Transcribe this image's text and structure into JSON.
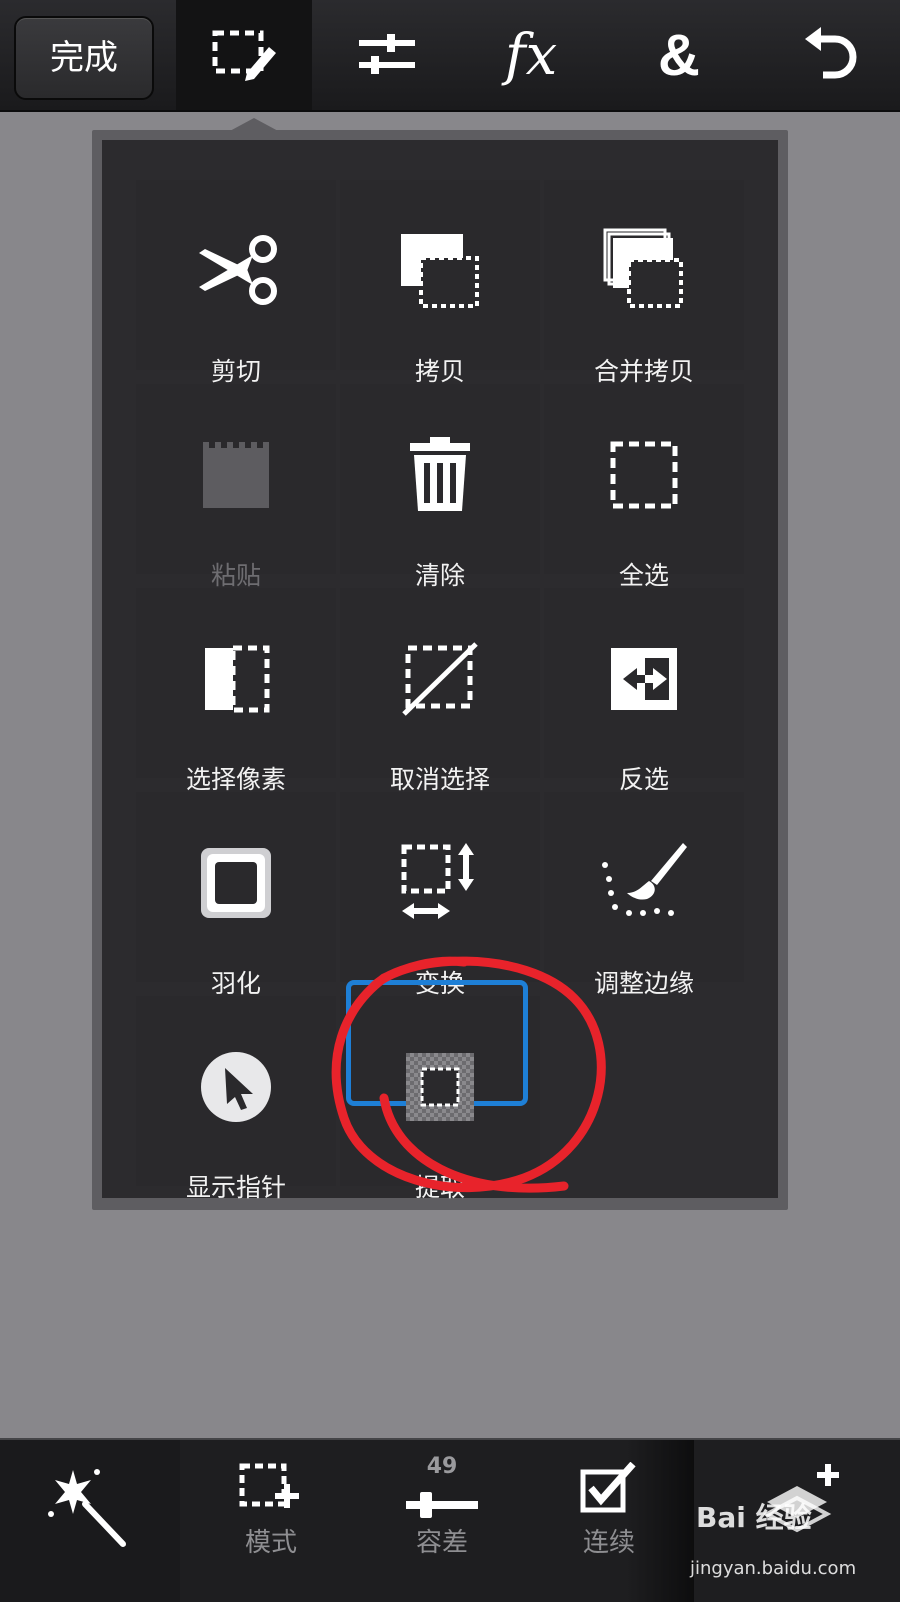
{
  "toolbar": {
    "done_label": "完成",
    "tools": [
      {
        "icon": "selection-edit-icon"
      },
      {
        "icon": "adjust-sliders-icon"
      },
      {
        "icon": "fx-icon",
        "label": "fx"
      },
      {
        "icon": "ampersand-icon",
        "label": "&"
      },
      {
        "icon": "undo-icon"
      }
    ]
  },
  "menu": {
    "items": [
      {
        "label": "剪切",
        "icon": "scissors-icon"
      },
      {
        "label": "拷贝",
        "icon": "copy-icon"
      },
      {
        "label": "合并拷贝",
        "icon": "merge-copy-icon"
      },
      {
        "label": "粘贴",
        "icon": "paste-icon",
        "disabled": true
      },
      {
        "label": "清除",
        "icon": "trash-icon"
      },
      {
        "label": "全选",
        "icon": "select-all-icon"
      },
      {
        "label": "选择像素",
        "icon": "select-pixels-icon"
      },
      {
        "label": "取消选择",
        "icon": "deselect-icon"
      },
      {
        "label": "反选",
        "icon": "invert-selection-icon"
      },
      {
        "label": "羽化",
        "icon": "feather-icon"
      },
      {
        "label": "变换",
        "icon": "transform-icon"
      },
      {
        "label": "调整边缘",
        "icon": "refine-edge-icon"
      },
      {
        "label": "显示指针",
        "icon": "pointer-icon"
      },
      {
        "label": "提取",
        "icon": "extract-icon",
        "highlighted": true
      }
    ]
  },
  "bottom": {
    "tabs": [
      {
        "icon": "magic-wand-icon"
      },
      {
        "label": "模式",
        "icon": "selection-add-icon"
      },
      {
        "label": "容差",
        "value": "49",
        "icon": "tolerance-slider-icon"
      },
      {
        "label": "连续",
        "icon": "contiguous-check-icon"
      },
      {
        "icon": "layer-add-icon"
      }
    ]
  },
  "watermark": {
    "brand": "Bai 经验",
    "url": "jingyan.baidu.com"
  },
  "colors": {
    "highlight_box": "#1e7fd6",
    "annotation_circle": "#e8232b"
  }
}
